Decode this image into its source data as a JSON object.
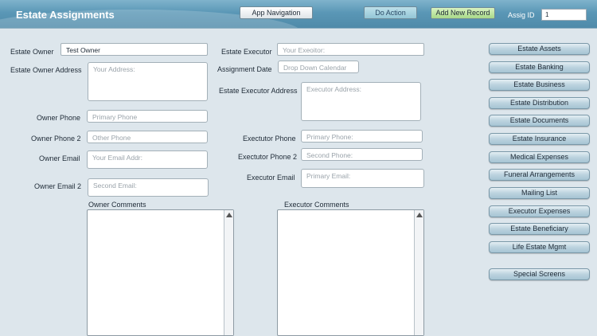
{
  "header": {
    "title": "Estate Assignments",
    "app_navigation": "App Navigation",
    "do_action": "Do Action",
    "add_new_record": "Add New Record",
    "assig_id_label": "Assig ID",
    "assig_id_value": "1"
  },
  "owner": {
    "owner_label": "Estate Owner",
    "owner_value": "Test Owner",
    "address_label": "Estate Owner Address",
    "address_placeholder": "Your Address:",
    "phone_label": "Owner Phone",
    "phone_placeholder": "Primary Phone",
    "phone2_label": "Owner Phone 2",
    "phone2_placeholder": "Other Phone",
    "email_label": "Owner Email",
    "email_placeholder": "Your Email Addr:",
    "email2_label": "Owner Email 2",
    "email2_placeholder": "Second Email:",
    "comments_label": "Owner Comments"
  },
  "executor": {
    "executor_label": "Estate Executor",
    "executor_placeholder": "Your Exeoitor:",
    "assignment_date_label": "Assignment Date",
    "assignment_date_placeholder": "Drop Down Calendar",
    "address_label": "Estate Executor Address",
    "address_placeholder": "Executor Address:",
    "phone_label": "Exectutor Phone",
    "phone_placeholder": "Primary Phone:",
    "phone2_label": "Exectutor Phone 2",
    "phone2_placeholder": "Second Phone:",
    "email_label": "Executor Email",
    "email_placeholder": "Primary Email:",
    "comments_label": "Executor Comments"
  },
  "sidebar": {
    "items": [
      "Estate Assets",
      "Estate Banking",
      "Estate Business",
      "Estate Distribution",
      "Estate Documents",
      "Estate Insurance",
      "Medical Expenses",
      "Funeral Arrangements",
      "Mailing List",
      "Executor Expenses",
      "Estate Beneficiary",
      "Life Estate Mgmt"
    ],
    "special": "Special Screens"
  }
}
